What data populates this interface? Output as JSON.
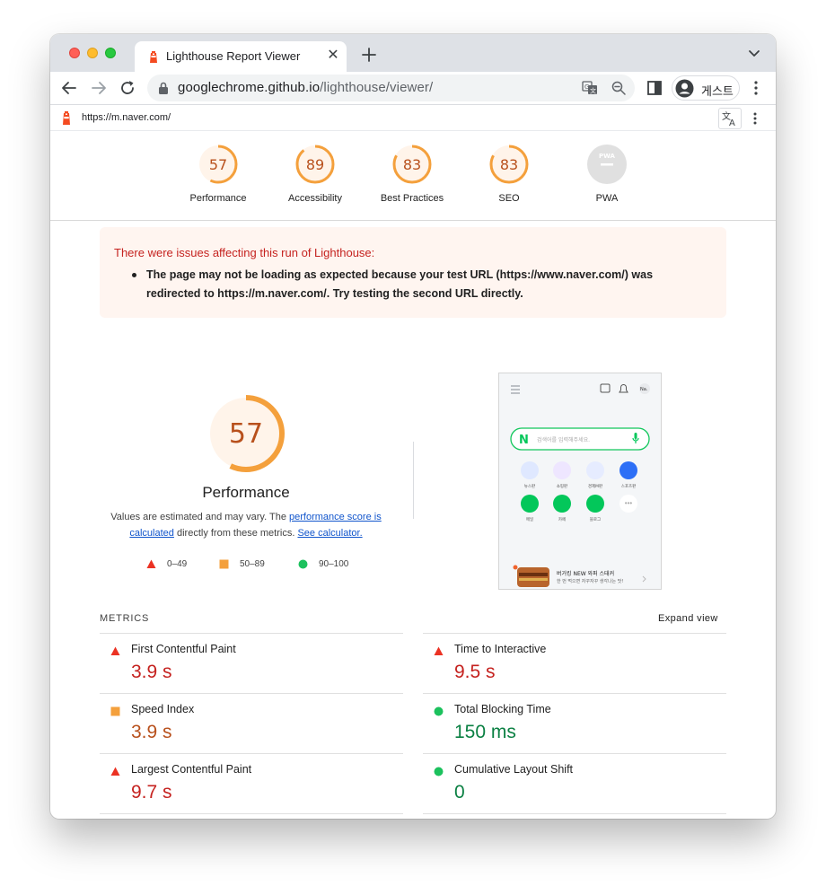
{
  "browser": {
    "tab_title": "Lighthouse Report Viewer",
    "url_host": "googlechrome.github.io",
    "url_path": "/lighthouse/viewer/",
    "profile_name": "게스트"
  },
  "report": {
    "url": "https://m.naver.com/"
  },
  "scores": [
    {
      "label": "Performance",
      "value": "57",
      "fraction": 0.57,
      "rating": "average"
    },
    {
      "label": "Accessibility",
      "value": "89",
      "fraction": 0.89,
      "rating": "average"
    },
    {
      "label": "Best Practices",
      "value": "83",
      "fraction": 0.83,
      "rating": "average"
    },
    {
      "label": "SEO",
      "value": "83",
      "fraction": 0.83,
      "rating": "average"
    },
    {
      "label": "PWA",
      "value": "PWA",
      "fraction": 0,
      "rating": "na"
    }
  ],
  "warning": {
    "title": "There were issues affecting this run of Lighthouse:",
    "item": "The page may not be loading as expected because your test URL (https://www.naver.com/) was redirected to https://m.naver.com/. Try testing the second URL directly."
  },
  "performance": {
    "score": "57",
    "score_fraction": 0.57,
    "title": "Performance",
    "desc_prefix": "Values are estimated and may vary. The ",
    "desc_link1": "performance score is calculated",
    "desc_middle": " directly from these metrics. ",
    "desc_link2": "See calculator."
  },
  "legend": [
    {
      "label": "0–49",
      "shape": "triangle",
      "color": "#eb3223"
    },
    {
      "label": "50–89",
      "shape": "square",
      "color": "#f4a03c"
    },
    {
      "label": "90–100",
      "shape": "circle",
      "color": "#1cc15d"
    }
  ],
  "screenshot": {
    "search_placeholder": "검색어를 입력해주세요.",
    "shortcut_labels": [
      "뉴스판",
      "쇼핑판",
      "경제M판",
      "스포츠판",
      "메일",
      "카페",
      "블로그",
      ""
    ],
    "ad_title": "버거킹 NEW 와퍼 스태커",
    "ad_sub": "한 번 먹으면 자꾸자꾸 생각나는 맛!"
  },
  "metrics": {
    "heading": "METRICS",
    "expand_label": "Expand view",
    "items": [
      {
        "name": "First Contentful Paint",
        "value": "3.9 s",
        "rating": "fail",
        "color": "#c5221f"
      },
      {
        "name": "Time to Interactive",
        "value": "9.5 s",
        "rating": "fail",
        "color": "#c5221f"
      },
      {
        "name": "Speed Index",
        "value": "3.9 s",
        "rating": "average",
        "color": "#b8501c"
      },
      {
        "name": "Total Blocking Time",
        "value": "150 ms",
        "rating": "pass",
        "color": "#0b8043"
      },
      {
        "name": "Largest Contentful Paint",
        "value": "9.7 s",
        "rating": "fail",
        "color": "#c5221f"
      },
      {
        "name": "Cumulative Layout Shift",
        "value": "0",
        "rating": "pass",
        "color": "#0b8043"
      }
    ]
  },
  "colors": {
    "average_arc": "#f4a03c",
    "average_text": "#b8501c",
    "average_fill": "#fff4ea",
    "fail": "#eb3223",
    "pass": "#1cc15d"
  }
}
